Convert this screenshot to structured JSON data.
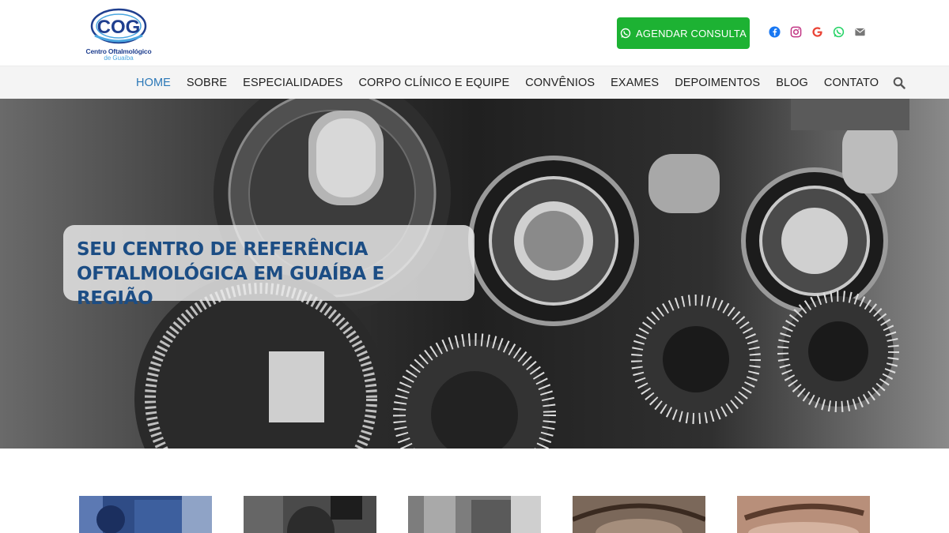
{
  "brand": {
    "logo_mark": "COG",
    "name_line1": "Centro Oftalmológico",
    "name_line2": "de Guaíba",
    "colors": {
      "primary": "#1f3f8f",
      "accent": "#4aa6e0"
    }
  },
  "header": {
    "cta_label": "AGENDAR CONSULTA",
    "cta_icon": "whatsapp-icon",
    "cta_color": "#1db233",
    "social": [
      {
        "name": "facebook-icon",
        "color": "#1877f2"
      },
      {
        "name": "instagram-icon",
        "color": "#c13584"
      },
      {
        "name": "google-icon",
        "color": "#ea4335"
      },
      {
        "name": "whatsapp-icon",
        "color": "#25d366"
      },
      {
        "name": "email-icon",
        "color": "#777777"
      }
    ]
  },
  "nav": {
    "items": [
      {
        "label": "HOME",
        "active": true
      },
      {
        "label": "SOBRE"
      },
      {
        "label": "ESPECIALIDADES"
      },
      {
        "label": "CORPO CLÍNICO E EQUIPE"
      },
      {
        "label": "CONVÊNIOS"
      },
      {
        "label": "EXAMES"
      },
      {
        "label": "DEPOIMENTOS"
      },
      {
        "label": "BLOG"
      },
      {
        "label": "CONTATO"
      }
    ],
    "search_icon": "search-icon",
    "active_color": "#2a77b7"
  },
  "hero": {
    "tagline_line1": "SEU CENTRO DE REFERÊNCIA",
    "tagline_line2": "OFTALMOLÓGICA EM GUAÍBA E REGIÃO",
    "tagline_color": "#1c4d84"
  },
  "thumbnails": [
    {
      "name": "clinic-building-photo"
    },
    {
      "name": "doctor-exam-photo"
    },
    {
      "name": "equipment-photo"
    },
    {
      "name": "eye-closeup-photo"
    },
    {
      "name": "eyebrow-photo"
    }
  ]
}
